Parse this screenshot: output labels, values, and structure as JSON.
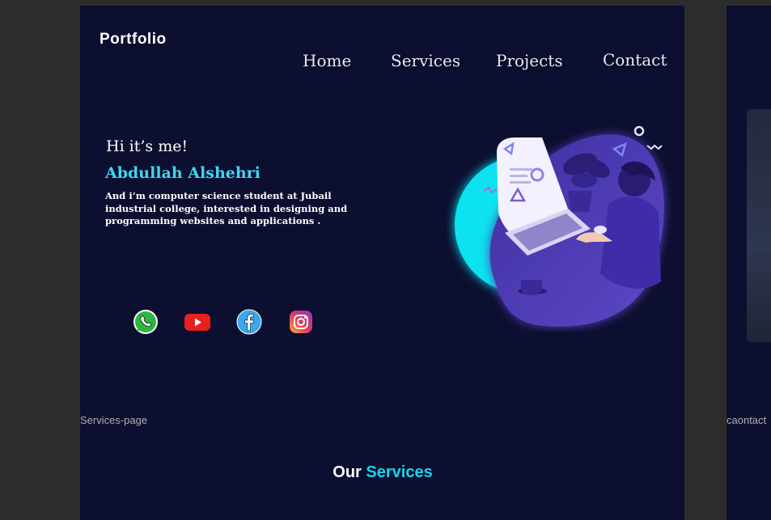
{
  "canvas": {
    "frame_labels": [
      "Services-page",
      "caontact"
    ]
  },
  "header": {
    "logo": "Portfolio",
    "nav": [
      "Home",
      "Services",
      "Projects",
      "Contact"
    ]
  },
  "hero": {
    "greeting": "Hi it’s me!",
    "name": "Abdullah Alshehri",
    "bio": "And i’m computer science student at Jubail industrial college, interested in designing and  programming websites and applications ."
  },
  "social": [
    {
      "icon": "whatsapp-icon"
    },
    {
      "icon": "youtube-icon"
    },
    {
      "icon": "facebook-icon"
    },
    {
      "icon": "instagram-icon"
    }
  ],
  "services": {
    "title_prefix": "Our",
    "title_accent": "Services"
  },
  "colors": {
    "background": "#0d0f30",
    "accent": "#1ad3ee",
    "canvas": "#2c2c2c"
  }
}
